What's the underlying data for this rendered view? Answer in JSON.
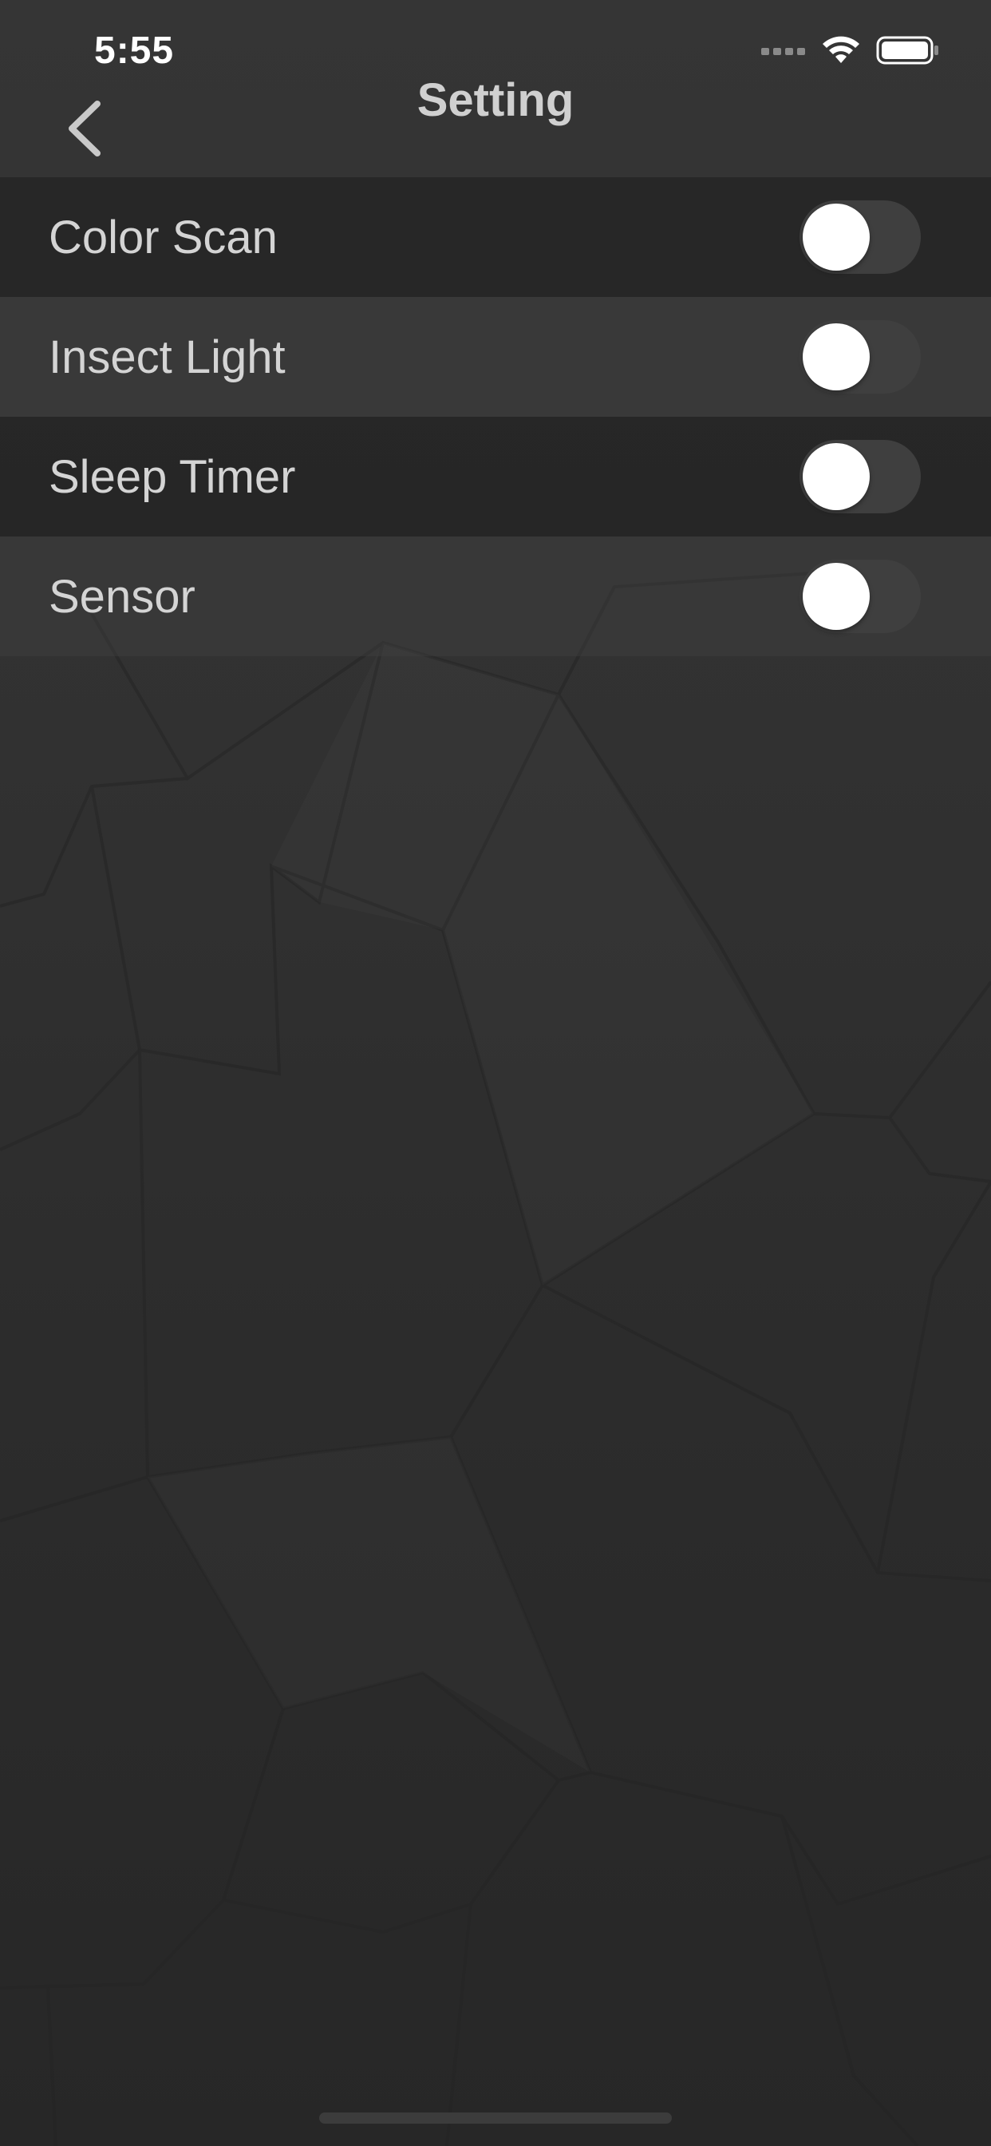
{
  "status_bar": {
    "time": "5:55",
    "icons": [
      "signal-dots-icon",
      "wifi-icon",
      "battery-icon"
    ]
  },
  "nav": {
    "title": "Setting",
    "back_icon": "chevron-left-icon"
  },
  "settings": [
    {
      "label": "Color Scan",
      "enabled": false
    },
    {
      "label": "Insect Light",
      "enabled": false
    },
    {
      "label": "Sleep Timer",
      "enabled": false
    },
    {
      "label": "Sensor",
      "enabled": false
    }
  ],
  "colors": {
    "background": "#2c2c2c",
    "text": "#d4d4d4",
    "toggle_track": "#3f3f3f",
    "toggle_knob": "#ffffff"
  }
}
